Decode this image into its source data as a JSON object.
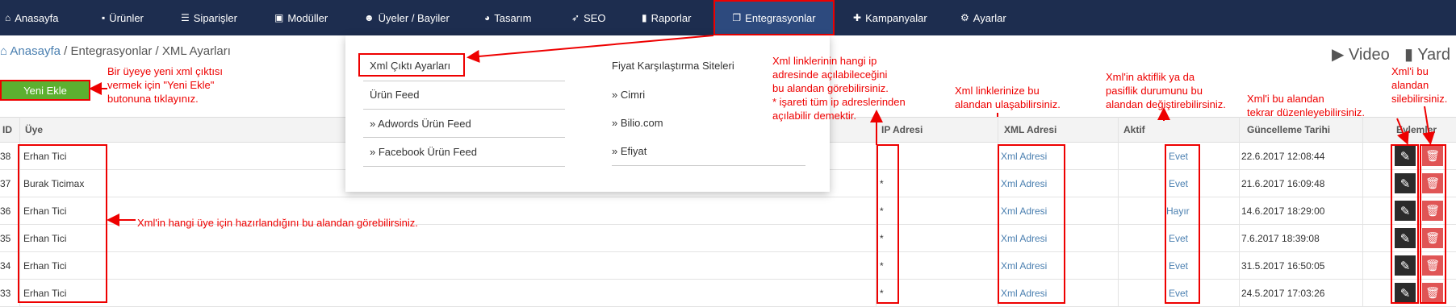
{
  "nav": {
    "items": [
      {
        "label": "Anasayfa",
        "icon": "home-icon"
      },
      {
        "label": "Ürünler",
        "icon": "box-icon"
      },
      {
        "label": "Siparişler",
        "icon": "list-icon"
      },
      {
        "label": "Modüller",
        "icon": "puzzle-icon"
      },
      {
        "label": "Üyeler / Bayiler",
        "icon": "users-icon"
      },
      {
        "label": "Tasarım",
        "icon": "palette-icon"
      },
      {
        "label": "SEO",
        "icon": "rocket-icon"
      },
      {
        "label": "Raporlar",
        "icon": "chart-icon"
      },
      {
        "label": "Entegrasyonlar",
        "icon": "copy-icon"
      },
      {
        "label": "Kampanyalar",
        "icon": "plus-icon"
      },
      {
        "label": "Ayarlar",
        "icon": "cog-icon"
      }
    ],
    "active": "Entegrasyonlar"
  },
  "breadcrumb": {
    "home": "Anasayfa",
    "sep": " / ",
    "rest": "Entegrasyonlar / XML Ayarları"
  },
  "top_links": {
    "video": "Video",
    "docs": "Yard"
  },
  "new_button": "Yeni Ekle",
  "dropdown": {
    "col1": [
      "Xml Çıktı Ayarları",
      "Ürün Feed",
      "» Adwords Ürün Feed",
      "» Facebook Ürün Feed"
    ],
    "col2": [
      "Fiyat Karşılaştırma Siteleri",
      "» Cimri",
      "» Bilio.com",
      "» Efiyat"
    ]
  },
  "table": {
    "headers": {
      "id": "ID",
      "member": "Üye",
      "ip": "IP Adresi",
      "xml": "XML Adresi",
      "active": "Aktif",
      "updated": "Güncelleme Tarihi",
      "actions": "Eylemler"
    },
    "rows": [
      {
        "id": "38",
        "member": "Erhan Tici",
        "ip": "",
        "xml": "Xml Adresi",
        "active": "Evet",
        "updated": "22.6.2017 12:08:44"
      },
      {
        "id": "37",
        "member": "Burak Ticimax",
        "ip": "*",
        "xml": "Xml Adresi",
        "active": "Evet",
        "updated": "21.6.2017 16:09:48"
      },
      {
        "id": "36",
        "member": "Erhan Tici",
        "ip": "*",
        "xml": "Xml Adresi",
        "active": "Hayır",
        "updated": "14.6.2017 18:29:00"
      },
      {
        "id": "35",
        "member": "Erhan Tici",
        "ip": "*",
        "xml": "Xml Adresi",
        "active": "Evet",
        "updated": "7.6.2017 18:39:08"
      },
      {
        "id": "34",
        "member": "Erhan Tici",
        "ip": "*",
        "xml": "Xml Adresi",
        "active": "Evet",
        "updated": "31.5.2017 16:50:05"
      },
      {
        "id": "33",
        "member": "Erhan Tici",
        "ip": "*",
        "xml": "Xml Adresi",
        "active": "Evet",
        "updated": "24.5.2017 17:03:26"
      }
    ]
  },
  "annotations": {
    "new_btn_note": [
      "Bir üyeye yeni xml çıktısı",
      "vermek için \"Yeni Ekle\"",
      "butonuna tıklayınız."
    ],
    "member_note": "Xml'in hangi üye için hazırlandığını bu alandan görebilirsiniz.",
    "ip_note": [
      "Xml linklerinin hangi ip",
      "adresinde açılabileceğini",
      "bu alandan görebilirsiniz.",
      "* işareti tüm ip adreslerinden",
      "açılabilir demektir."
    ],
    "xml_note": [
      "Xml linklerinize bu",
      "alandan ulaşabilirsiniz."
    ],
    "active_note": [
      "Xml'in aktiflik ya da",
      "pasiflik durumunu bu",
      "alandan değiştirebilirsiniz."
    ],
    "edit_note": [
      "Xml'i bu alandan",
      "tekrar düzenleyebilirsiniz."
    ],
    "delete_note": [
      "Xml'i bu",
      "alandan",
      "silebilirsiniz."
    ]
  }
}
